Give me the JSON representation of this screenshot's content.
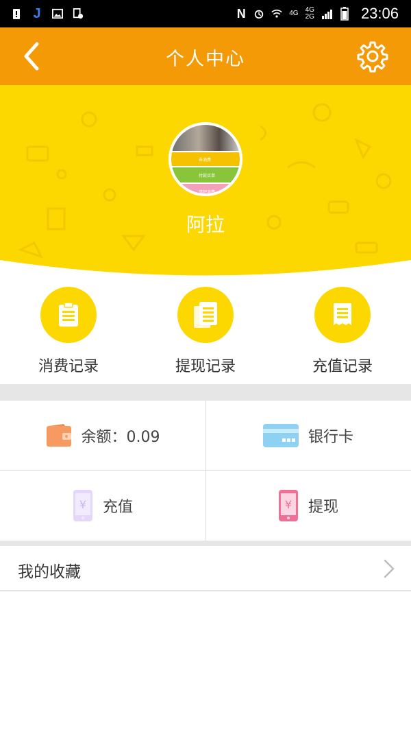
{
  "status_bar": {
    "time": "23:06",
    "network_1": "4G",
    "network_2": "4G",
    "network_3": "2G"
  },
  "header": {
    "title": "个人中心",
    "back_icon": "chevron-left-icon",
    "settings_icon": "gear-icon"
  },
  "profile": {
    "username": "阿拉",
    "avatar_rows": [
      "去消费",
      "付款买单",
      "请积消费"
    ]
  },
  "records": [
    {
      "label": "消费记录",
      "icon": "clipboard-icon"
    },
    {
      "label": "提现记录",
      "icon": "documents-icon"
    },
    {
      "label": "充值记录",
      "icon": "receipt-icon"
    }
  ],
  "wallet": {
    "balance_label": "余额：0.09",
    "bank_card_label": "银行卡",
    "recharge_label": "充值",
    "withdraw_label": "提现"
  },
  "favorites": {
    "label": "我的收藏"
  },
  "colors": {
    "app_bar": "#f39a06",
    "hero": "#fcd800",
    "wallet_icon": "#f79a61",
    "card_icon": "#8ed1f2",
    "recharge_icon": "#e5d6fb",
    "withdraw_icon": "#f06f95"
  }
}
